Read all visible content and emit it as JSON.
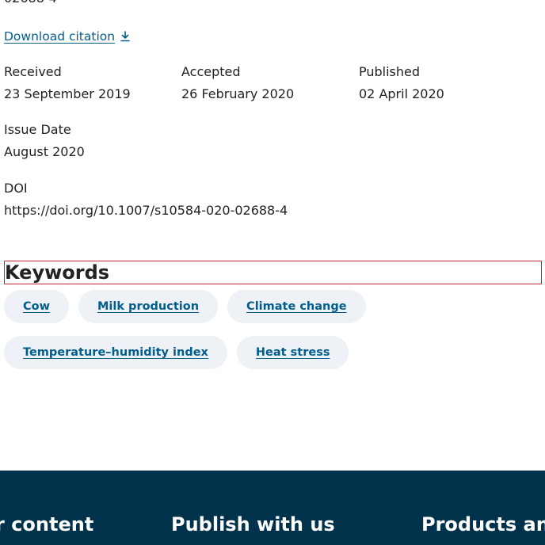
{
  "top_partial_text": "02688-4",
  "download_citation": {
    "label": "Download citation",
    "icon": "download-icon"
  },
  "dates": {
    "received": {
      "label": "Received",
      "value": "23 September 2019"
    },
    "accepted": {
      "label": "Accepted",
      "value": "26 February 2020"
    },
    "published": {
      "label": "Published",
      "value": "02 April 2020"
    },
    "issue_date": {
      "label": "Issue Date",
      "value": "August 2020"
    }
  },
  "doi": {
    "label": "DOI",
    "value": "https://doi.org/10.1007/s10584-020-02688-4"
  },
  "keywords": {
    "heading": "Keywords",
    "items": [
      "Cow",
      "Milk production",
      "Climate change",
      "Temperature–humidity index",
      "Heat stress"
    ]
  },
  "footer": {
    "headings": [
      "r content",
      "Publish with us",
      "Products and"
    ]
  },
  "colors": {
    "link": "#025e8d",
    "chip_bg": "#eef1f5",
    "footer_bg": "#01324b",
    "highlight_border": "#c0272d"
  }
}
